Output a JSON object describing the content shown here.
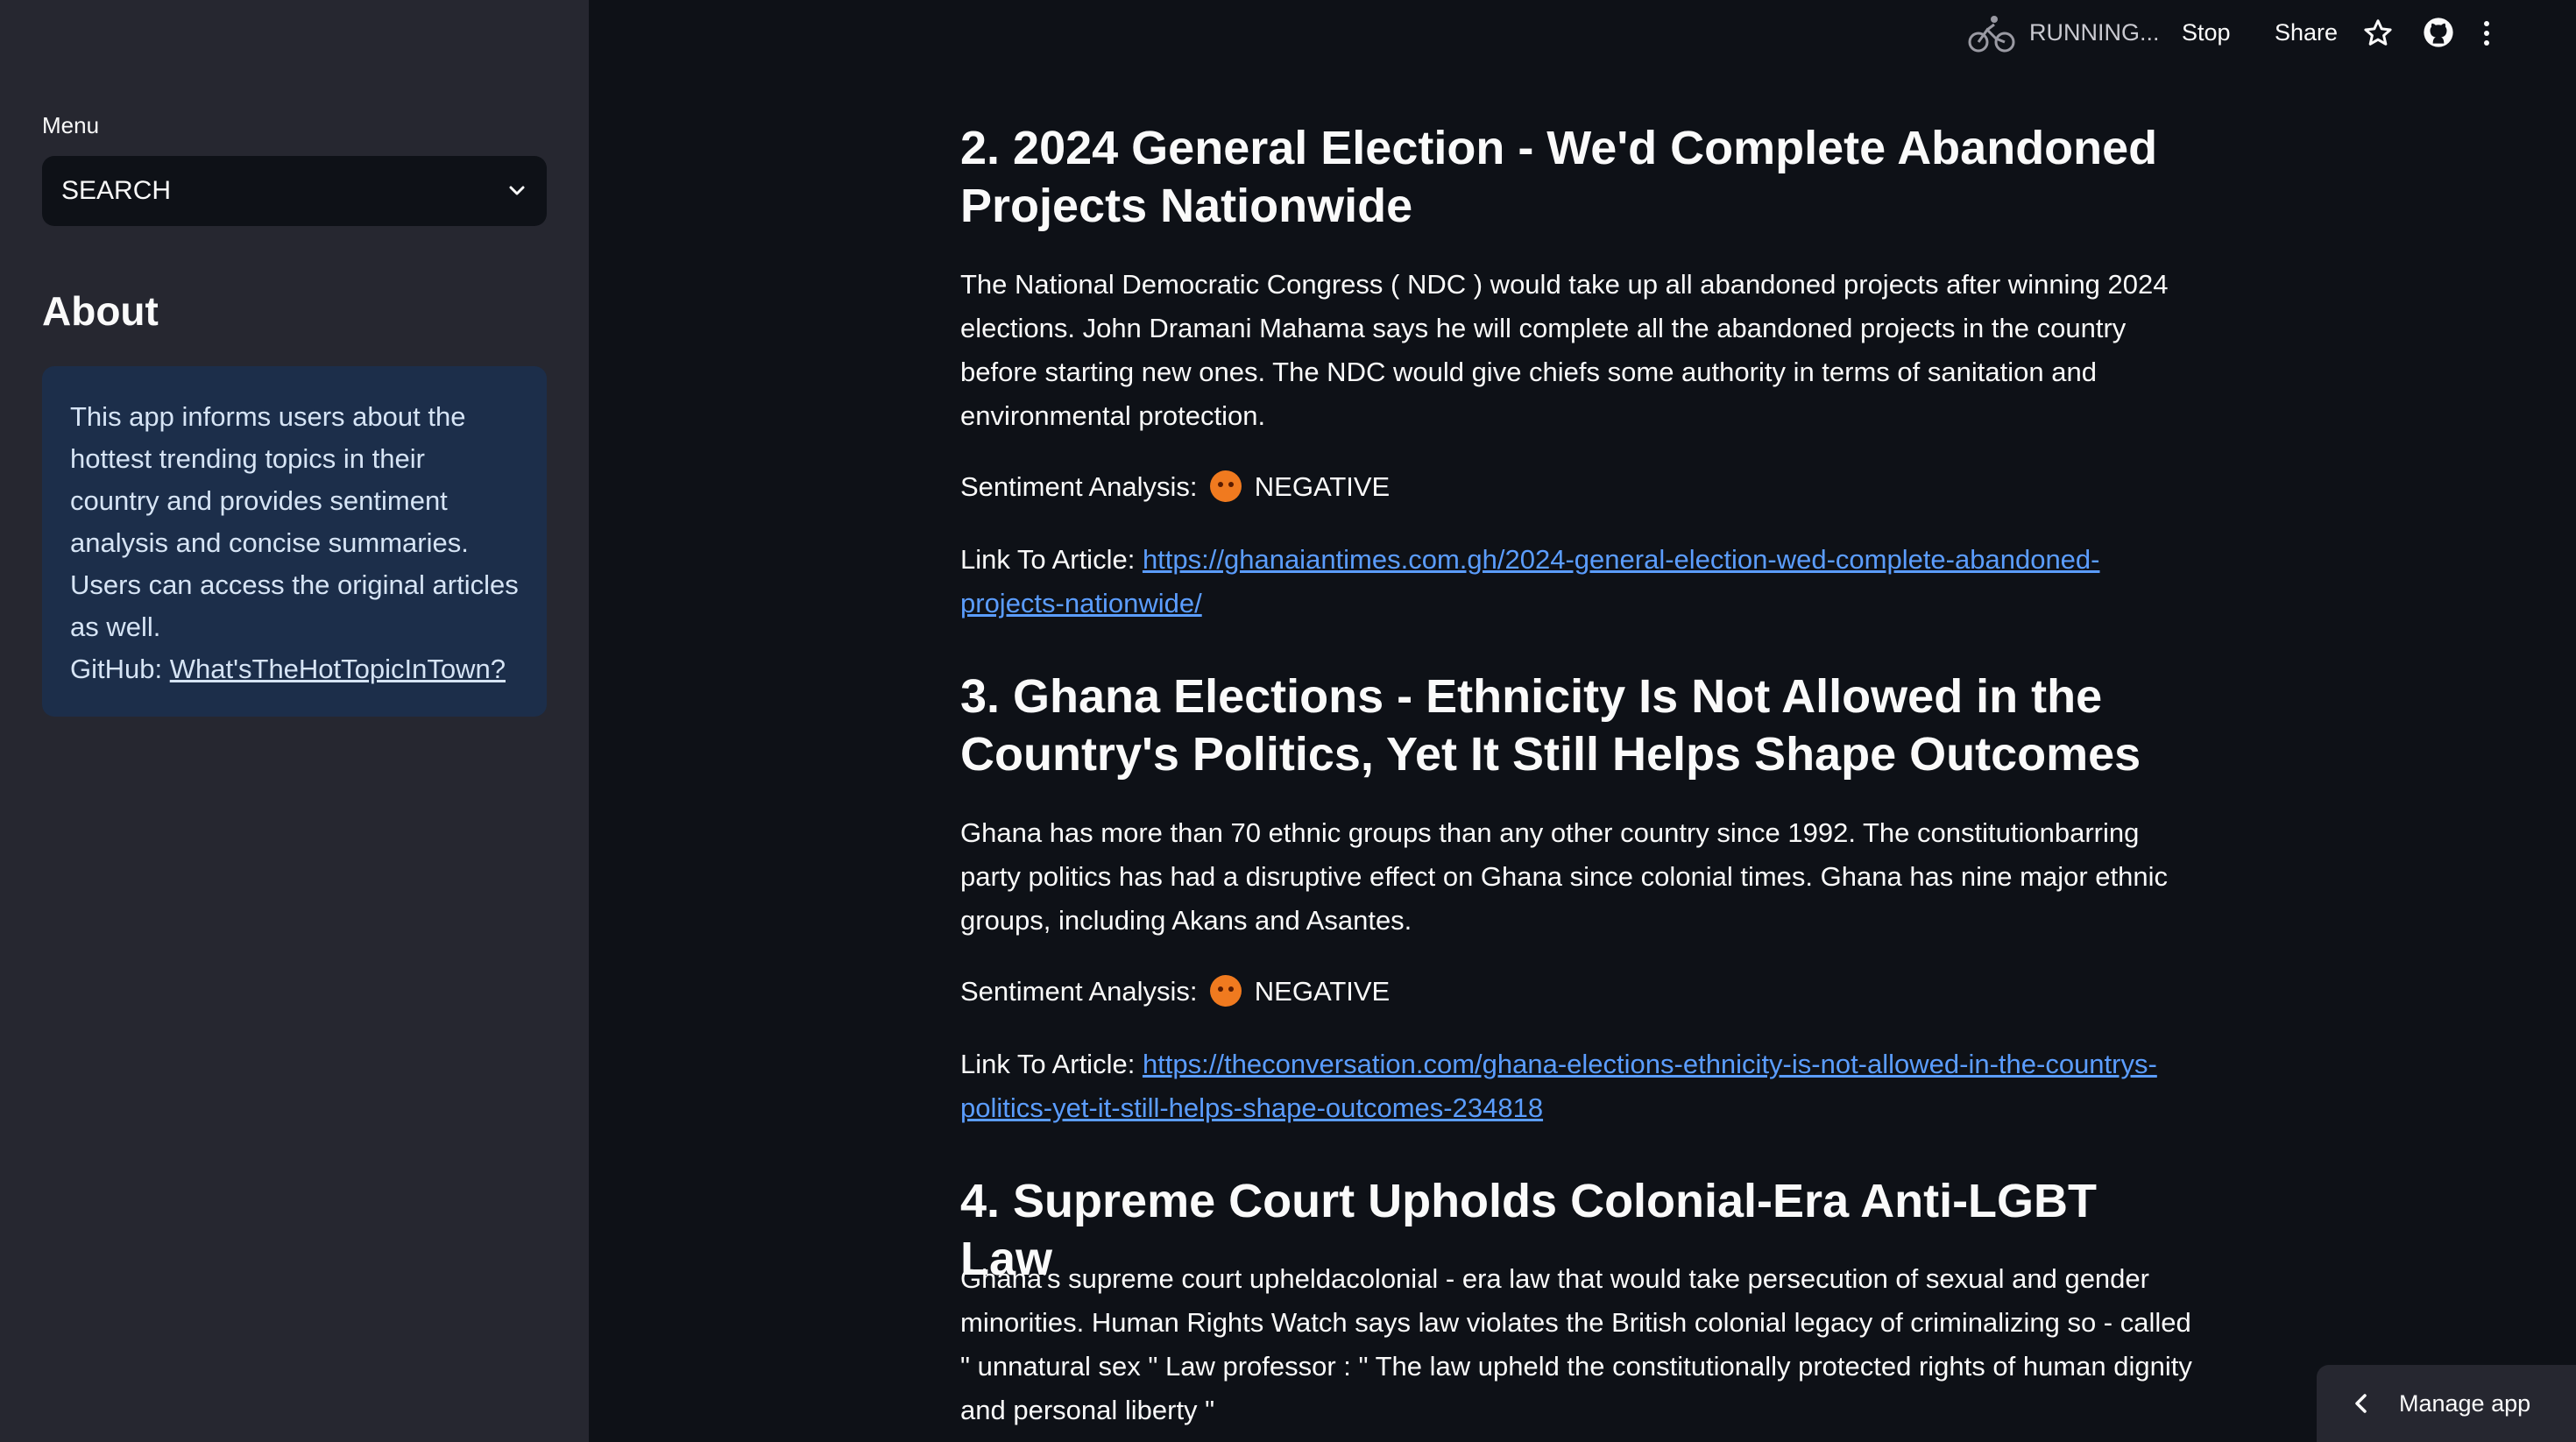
{
  "sidebar": {
    "menu_label": "Menu",
    "select_value": "SEARCH",
    "about_title": "About",
    "about_text": "This app informs users about the hottest trending topics in their country and provides sentiment analysis and concise summaries. Users can access the original articles as well.",
    "github_label": "GitHub:",
    "github_link": "What'sTheHotTopicInTown?"
  },
  "header": {
    "status": "RUNNING...",
    "stop": "Stop",
    "share": "Share"
  },
  "articles": [
    {
      "title": "2. 2024 General Election - We'd Complete Abandoned Projects Nationwide",
      "summary": "The National Democratic Congress ( NDC ) would take up all abandoned projects after winning 2024 elections. John Dramani Mahama says he will complete all the abandoned projects in the country before starting new ones. The NDC would give chiefs some authority in terms of sanitation and environmental protection.",
      "sentiment_label": "Sentiment Analysis:",
      "sentiment": "NEGATIVE",
      "link_label": "Link To Article:",
      "link": "https://ghanaiantimes.com.gh/2024-general-election-wed-complete-abandoned-projects-nationwide/"
    },
    {
      "title": "3. Ghana Elections - Ethnicity Is Not Allowed in the Country's Politics, Yet It Still Helps Shape Outcomes",
      "summary": "Ghana has more than 70 ethnic groups than any other country since 1992. The constitutionbarring party politics has had a disruptive effect on Ghana since colonial times. Ghana has nine major ethnic groups, including Akans and Asantes.",
      "sentiment_label": "Sentiment Analysis:",
      "sentiment": "NEGATIVE",
      "link_label": "Link To Article:",
      "link": "https://theconversation.com/ghana-elections-ethnicity-is-not-allowed-in-the-countrys-politics-yet-it-still-helps-shape-outcomes-234818"
    },
    {
      "title": "4. Supreme Court Upholds Colonial-Era Anti-LGBT Law",
      "summary": "Ghana's supreme court upheldacolonial - era law that would take persecution of sexual and gender minorities. Human Rights Watch says law violates the British colonial legacy of criminalizing so - called \" unnatural sex \" Law professor : \" The law upheld the constitutionally protected rights of human dignity and personal liberty \""
    }
  ],
  "manage_app": "Manage app"
}
